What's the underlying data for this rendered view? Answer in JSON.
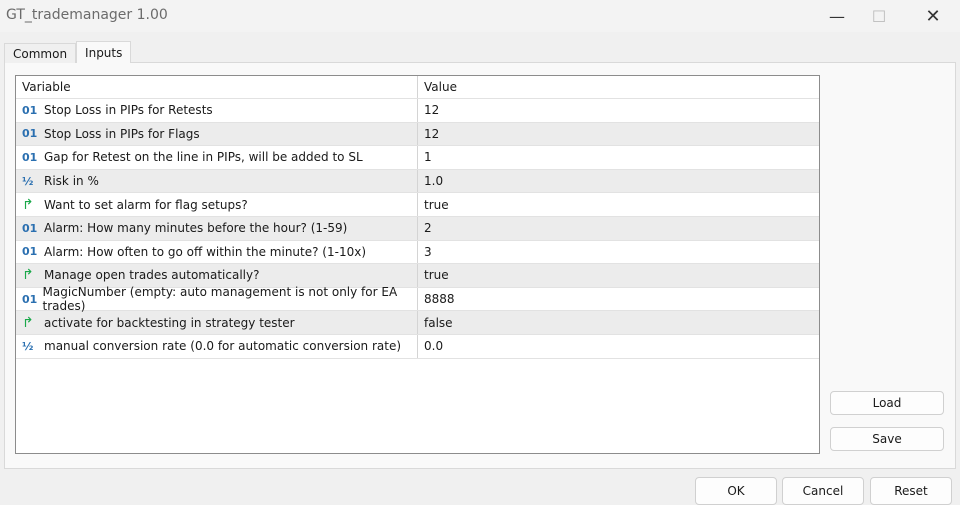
{
  "window": {
    "title": "GT_trademanager 1.00"
  },
  "tabs": [
    {
      "label": "Common"
    },
    {
      "label": "Inputs",
      "active": true
    }
  ],
  "table": {
    "headers": [
      "Variable",
      "Value"
    ],
    "rows": [
      {
        "type": "int",
        "icon": "01",
        "variable": "Stop Loss in PIPs for Retests",
        "value": "12"
      },
      {
        "type": "int",
        "icon": "01",
        "variable": "Stop Loss in PIPs for Flags",
        "value": "12"
      },
      {
        "type": "int",
        "icon": "01",
        "variable": "Gap for Retest on the line in PIPs, will be added to SL",
        "value": "1"
      },
      {
        "type": "double",
        "icon": "½",
        "variable": "Risk in %",
        "value": "1.0"
      },
      {
        "type": "bool",
        "icon": "↱",
        "variable": "Want to set alarm for flag setups?",
        "value": "true"
      },
      {
        "type": "int",
        "icon": "01",
        "variable": "Alarm: How many minutes before the hour? (1-59)",
        "value": "2"
      },
      {
        "type": "int",
        "icon": "01",
        "variable": "Alarm: How often to go off within the minute? (1-10x)",
        "value": "3"
      },
      {
        "type": "bool",
        "icon": "↱",
        "variable": "Manage open trades automatically?",
        "value": "true"
      },
      {
        "type": "int",
        "icon": "01",
        "variable": "MagicNumber (empty: auto management is not only for EA trades)",
        "value": "8888"
      },
      {
        "type": "bool",
        "icon": "↱",
        "variable": "activate for backtesting in strategy tester",
        "value": "false"
      },
      {
        "type": "double",
        "icon": "½",
        "variable": "manual conversion rate (0.0 for automatic conversion rate)",
        "value": "0.0"
      }
    ]
  },
  "side_buttons": {
    "load": "Load",
    "save": "Save"
  },
  "footer": {
    "ok": "OK",
    "cancel": "Cancel",
    "reset": "Reset"
  },
  "colors": {
    "int_icon": "#2a6fb0",
    "bool_icon": "#1aa84a"
  }
}
